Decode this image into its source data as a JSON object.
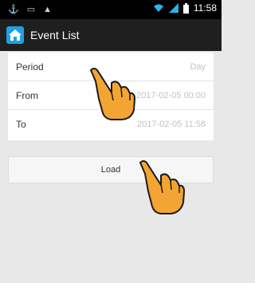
{
  "status_bar": {
    "left_icons": [
      "usb-icon",
      "sd-card-icon",
      "warning-icon"
    ],
    "right_icons": [
      "wifi-icon",
      "signal-icon",
      "battery-icon"
    ],
    "time": "11:58"
  },
  "app_bar": {
    "icon": "home-icon",
    "title": "Event List"
  },
  "form": {
    "rows": [
      {
        "label": "Period",
        "value": "Day"
      },
      {
        "label": "From",
        "value": "2017-02-05 00:00"
      },
      {
        "label": "To",
        "value": "2017-02-05 11:58"
      }
    ]
  },
  "load_button": {
    "label": "Load"
  },
  "colors": {
    "status_bar": "#000000",
    "app_bar": "#1f1f1f",
    "home_icon": "#1ea0e6",
    "hand": "#f2a533",
    "background": "#e8e8e8"
  },
  "annotations": [
    "hand-pointer-icon",
    "hand-pointer-icon"
  ]
}
